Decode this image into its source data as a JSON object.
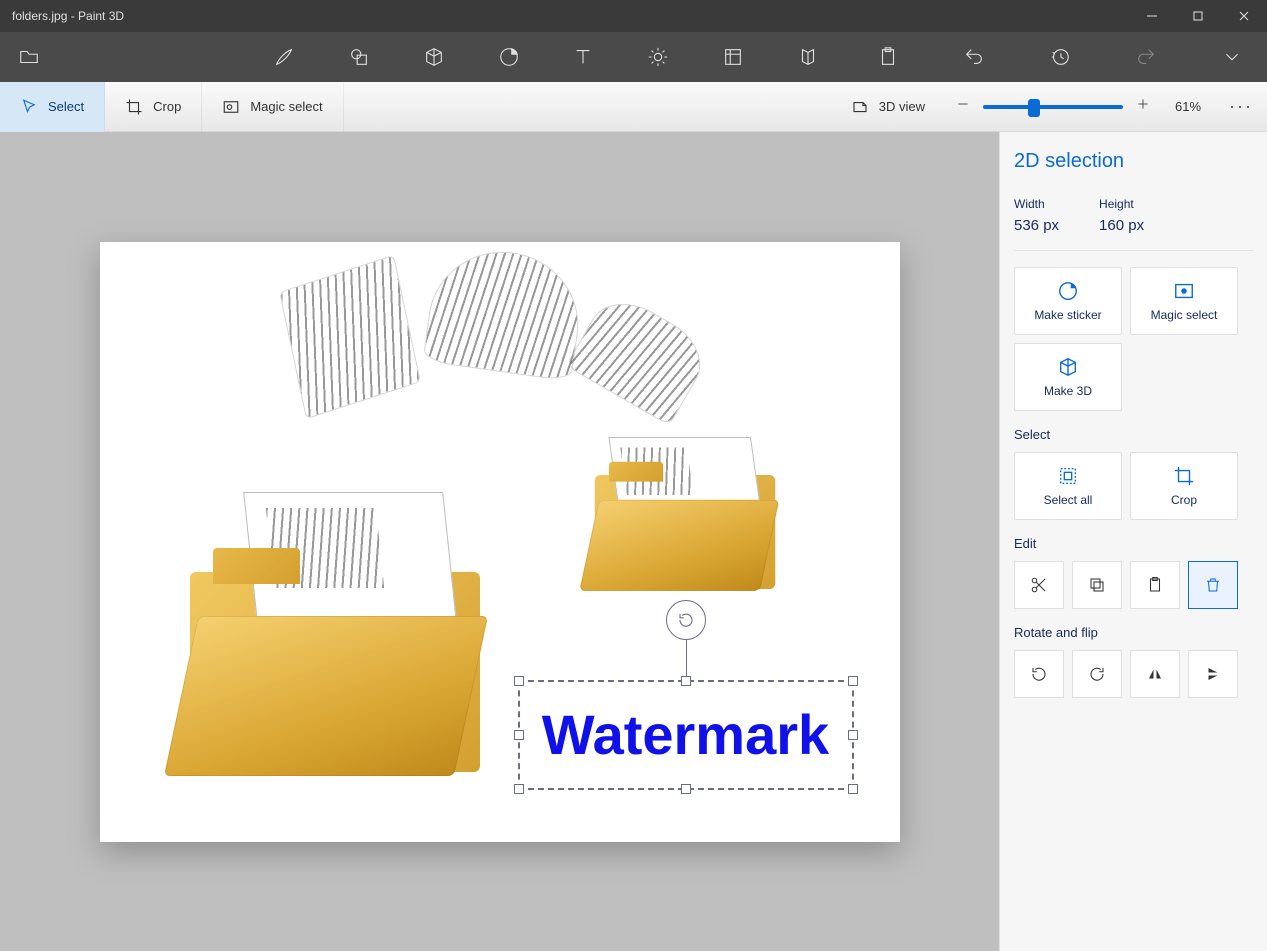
{
  "title": "folders.jpg - Paint 3D",
  "tools": {
    "select": "Select",
    "crop": "Crop",
    "magic_select": "Magic select",
    "view3d": "3D view"
  },
  "zoom": "61%",
  "canvas": {
    "watermark_text": "Watermark"
  },
  "panel": {
    "title": "2D selection",
    "width_label": "Width",
    "width_val": "536 px",
    "height_label": "Height",
    "height_val": "160 px",
    "make_sticker": "Make sticker",
    "magic_select": "Magic select",
    "make_3d": "Make 3D",
    "select_header": "Select",
    "select_all": "Select all",
    "crop": "Crop",
    "edit_header": "Edit",
    "rotate_header": "Rotate and flip"
  }
}
